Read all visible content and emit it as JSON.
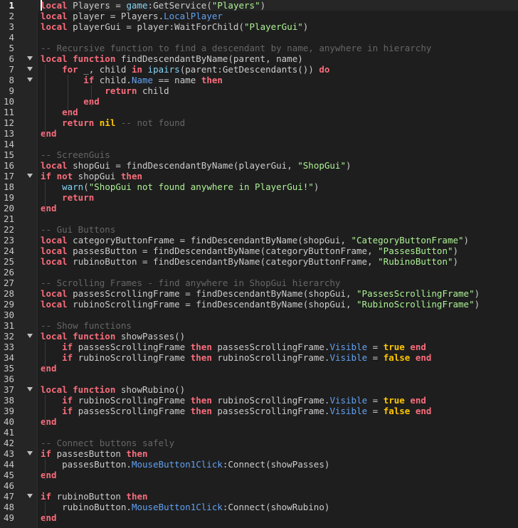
{
  "editor": {
    "lines": [
      {
        "n": "1",
        "fold": false,
        "tokens": [
          {
            "t": "local",
            "c": "kw"
          },
          {
            "t": " Players = ",
            "c": "id"
          },
          {
            "t": "game",
            "c": "bi"
          },
          {
            "t": ":GetService(",
            "c": "id"
          },
          {
            "t": "\"Players\"",
            "c": "str"
          },
          {
            "t": ")",
            "c": "id"
          }
        ]
      },
      {
        "n": "2",
        "fold": false,
        "tokens": [
          {
            "t": "local",
            "c": "kw"
          },
          {
            "t": " player = Players.",
            "c": "id"
          },
          {
            "t": "LocalPlayer",
            "c": "prop"
          }
        ]
      },
      {
        "n": "3",
        "fold": false,
        "tokens": [
          {
            "t": "local",
            "c": "kw"
          },
          {
            "t": " playerGui = player:WaitForChild(",
            "c": "id"
          },
          {
            "t": "\"PlayerGui\"",
            "c": "str"
          },
          {
            "t": ")",
            "c": "id"
          }
        ]
      },
      {
        "n": "4",
        "fold": false,
        "tokens": []
      },
      {
        "n": "5",
        "fold": false,
        "tokens": [
          {
            "t": "-- Recursive function to find a descendant by name, anywhere in hierarchy",
            "c": "com"
          }
        ]
      },
      {
        "n": "6",
        "fold": true,
        "tokens": [
          {
            "t": "local function",
            "c": "kw"
          },
          {
            "t": " findDescendantByName(parent, name)",
            "c": "id"
          }
        ]
      },
      {
        "n": "7",
        "fold": true,
        "tokens": [
          {
            "t": "    ",
            "c": "id"
          },
          {
            "t": "for",
            "c": "kw"
          },
          {
            "t": " _, child ",
            "c": "id"
          },
          {
            "t": "in",
            "c": "kw"
          },
          {
            "t": " ",
            "c": "id"
          },
          {
            "t": "ipairs",
            "c": "bi"
          },
          {
            "t": "(parent:GetDescendants()) ",
            "c": "id"
          },
          {
            "t": "do",
            "c": "kw"
          }
        ]
      },
      {
        "n": "8",
        "fold": true,
        "tokens": [
          {
            "t": "        ",
            "c": "id"
          },
          {
            "t": "if",
            "c": "kw"
          },
          {
            "t": " child.",
            "c": "id"
          },
          {
            "t": "Name",
            "c": "prop"
          },
          {
            "t": " == name ",
            "c": "id"
          },
          {
            "t": "then",
            "c": "kw"
          }
        ]
      },
      {
        "n": "9",
        "fold": false,
        "tokens": [
          {
            "t": "            ",
            "c": "id"
          },
          {
            "t": "return",
            "c": "kw"
          },
          {
            "t": " child",
            "c": "id"
          }
        ]
      },
      {
        "n": "10",
        "fold": false,
        "tokens": [
          {
            "t": "        ",
            "c": "id"
          },
          {
            "t": "end",
            "c": "kw"
          }
        ]
      },
      {
        "n": "11",
        "fold": false,
        "tokens": [
          {
            "t": "    ",
            "c": "id"
          },
          {
            "t": "end",
            "c": "kw"
          }
        ]
      },
      {
        "n": "12",
        "fold": false,
        "tokens": [
          {
            "t": "    ",
            "c": "id"
          },
          {
            "t": "return",
            "c": "kw"
          },
          {
            "t": " ",
            "c": "id"
          },
          {
            "t": "nil",
            "c": "bool"
          },
          {
            "t": " -- not found",
            "c": "com"
          }
        ]
      },
      {
        "n": "13",
        "fold": false,
        "tokens": [
          {
            "t": "end",
            "c": "kw"
          }
        ]
      },
      {
        "n": "14",
        "fold": false,
        "tokens": []
      },
      {
        "n": "15",
        "fold": false,
        "tokens": [
          {
            "t": "-- ScreenGuis",
            "c": "com"
          }
        ]
      },
      {
        "n": "16",
        "fold": false,
        "tokens": [
          {
            "t": "local",
            "c": "kw"
          },
          {
            "t": " shopGui = findDescendantByName(playerGui, ",
            "c": "id"
          },
          {
            "t": "\"ShopGui\"",
            "c": "str"
          },
          {
            "t": ")",
            "c": "id"
          }
        ]
      },
      {
        "n": "17",
        "fold": true,
        "tokens": [
          {
            "t": "if not",
            "c": "kw"
          },
          {
            "t": " shopGui ",
            "c": "id"
          },
          {
            "t": "then",
            "c": "kw"
          }
        ]
      },
      {
        "n": "18",
        "fold": false,
        "tokens": [
          {
            "t": "    ",
            "c": "id"
          },
          {
            "t": "warn",
            "c": "bi"
          },
          {
            "t": "(",
            "c": "id"
          },
          {
            "t": "\"ShopGui not found anywhere in PlayerGui!\"",
            "c": "str"
          },
          {
            "t": ")",
            "c": "id"
          }
        ]
      },
      {
        "n": "19",
        "fold": false,
        "tokens": [
          {
            "t": "    ",
            "c": "id"
          },
          {
            "t": "return",
            "c": "kw"
          }
        ]
      },
      {
        "n": "20",
        "fold": false,
        "tokens": [
          {
            "t": "end",
            "c": "kw"
          }
        ]
      },
      {
        "n": "21",
        "fold": false,
        "tokens": []
      },
      {
        "n": "22",
        "fold": false,
        "tokens": [
          {
            "t": "-- Gui Buttons",
            "c": "com"
          }
        ]
      },
      {
        "n": "23",
        "fold": false,
        "tokens": [
          {
            "t": "local",
            "c": "kw"
          },
          {
            "t": " categoryButtonFrame = findDescendantByName(shopGui, ",
            "c": "id"
          },
          {
            "t": "\"CategoryButtonFrame\"",
            "c": "str"
          },
          {
            "t": ")",
            "c": "id"
          }
        ]
      },
      {
        "n": "24",
        "fold": false,
        "tokens": [
          {
            "t": "local",
            "c": "kw"
          },
          {
            "t": " passesButton = findDescendantByName(categoryButtonFrame, ",
            "c": "id"
          },
          {
            "t": "\"PassesButton\"",
            "c": "str"
          },
          {
            "t": ")",
            "c": "id"
          }
        ]
      },
      {
        "n": "25",
        "fold": false,
        "tokens": [
          {
            "t": "local",
            "c": "kw"
          },
          {
            "t": " rubinoButton = findDescendantByName(categoryButtonFrame, ",
            "c": "id"
          },
          {
            "t": "\"RubinoButton\"",
            "c": "str"
          },
          {
            "t": ")",
            "c": "id"
          }
        ]
      },
      {
        "n": "26",
        "fold": false,
        "tokens": []
      },
      {
        "n": "27",
        "fold": false,
        "tokens": [
          {
            "t": "-- Scrolling Frames - find anywhere in ShopGui hierarchy",
            "c": "com"
          }
        ]
      },
      {
        "n": "28",
        "fold": false,
        "tokens": [
          {
            "t": "local",
            "c": "kw"
          },
          {
            "t": " passesScrollingFrame = findDescendantByName(shopGui, ",
            "c": "id"
          },
          {
            "t": "\"PassesScrollingFrame\"",
            "c": "str"
          },
          {
            "t": ")",
            "c": "id"
          }
        ]
      },
      {
        "n": "29",
        "fold": false,
        "tokens": [
          {
            "t": "local",
            "c": "kw"
          },
          {
            "t": " rubinoScrollingFrame = findDescendantByName(shopGui, ",
            "c": "id"
          },
          {
            "t": "\"RubinoScrollingFrame\"",
            "c": "str"
          },
          {
            "t": ")",
            "c": "id"
          }
        ]
      },
      {
        "n": "30",
        "fold": false,
        "tokens": []
      },
      {
        "n": "31",
        "fold": false,
        "tokens": [
          {
            "t": "-- Show functions",
            "c": "com"
          }
        ]
      },
      {
        "n": "32",
        "fold": true,
        "tokens": [
          {
            "t": "local function",
            "c": "kw"
          },
          {
            "t": " showPasses()",
            "c": "id"
          }
        ]
      },
      {
        "n": "33",
        "fold": false,
        "tokens": [
          {
            "t": "    ",
            "c": "id"
          },
          {
            "t": "if",
            "c": "kw"
          },
          {
            "t": " passesScrollingFrame ",
            "c": "id"
          },
          {
            "t": "then",
            "c": "kw"
          },
          {
            "t": " passesScrollingFrame.",
            "c": "id"
          },
          {
            "t": "Visible",
            "c": "prop"
          },
          {
            "t": " = ",
            "c": "id"
          },
          {
            "t": "true",
            "c": "bool"
          },
          {
            "t": " ",
            "c": "id"
          },
          {
            "t": "end",
            "c": "kw"
          }
        ]
      },
      {
        "n": "34",
        "fold": false,
        "tokens": [
          {
            "t": "    ",
            "c": "id"
          },
          {
            "t": "if",
            "c": "kw"
          },
          {
            "t": " rubinoScrollingFrame ",
            "c": "id"
          },
          {
            "t": "then",
            "c": "kw"
          },
          {
            "t": " rubinoScrollingFrame.",
            "c": "id"
          },
          {
            "t": "Visible",
            "c": "prop"
          },
          {
            "t": " = ",
            "c": "id"
          },
          {
            "t": "false",
            "c": "bool"
          },
          {
            "t": " ",
            "c": "id"
          },
          {
            "t": "end",
            "c": "kw"
          }
        ]
      },
      {
        "n": "35",
        "fold": false,
        "tokens": [
          {
            "t": "end",
            "c": "kw"
          }
        ]
      },
      {
        "n": "36",
        "fold": false,
        "tokens": []
      },
      {
        "n": "37",
        "fold": true,
        "tokens": [
          {
            "t": "local function",
            "c": "kw"
          },
          {
            "t": " showRubino()",
            "c": "id"
          }
        ]
      },
      {
        "n": "38",
        "fold": false,
        "tokens": [
          {
            "t": "    ",
            "c": "id"
          },
          {
            "t": "if",
            "c": "kw"
          },
          {
            "t": " rubinoScrollingFrame ",
            "c": "id"
          },
          {
            "t": "then",
            "c": "kw"
          },
          {
            "t": " rubinoScrollingFrame.",
            "c": "id"
          },
          {
            "t": "Visible",
            "c": "prop"
          },
          {
            "t": " = ",
            "c": "id"
          },
          {
            "t": "true",
            "c": "bool"
          },
          {
            "t": " ",
            "c": "id"
          },
          {
            "t": "end",
            "c": "kw"
          }
        ]
      },
      {
        "n": "39",
        "fold": false,
        "tokens": [
          {
            "t": "    ",
            "c": "id"
          },
          {
            "t": "if",
            "c": "kw"
          },
          {
            "t": " passesScrollingFrame ",
            "c": "id"
          },
          {
            "t": "then",
            "c": "kw"
          },
          {
            "t": " passesScrollingFrame.",
            "c": "id"
          },
          {
            "t": "Visible",
            "c": "prop"
          },
          {
            "t": " = ",
            "c": "id"
          },
          {
            "t": "false",
            "c": "bool"
          },
          {
            "t": " ",
            "c": "id"
          },
          {
            "t": "end",
            "c": "kw"
          }
        ]
      },
      {
        "n": "40",
        "fold": false,
        "tokens": [
          {
            "t": "end",
            "c": "kw"
          }
        ]
      },
      {
        "n": "41",
        "fold": false,
        "tokens": []
      },
      {
        "n": "42",
        "fold": false,
        "tokens": [
          {
            "t": "-- Connect buttons safely",
            "c": "com"
          }
        ]
      },
      {
        "n": "43",
        "fold": true,
        "tokens": [
          {
            "t": "if",
            "c": "kw"
          },
          {
            "t": " passesButton ",
            "c": "id"
          },
          {
            "t": "then",
            "c": "kw"
          }
        ]
      },
      {
        "n": "44",
        "fold": false,
        "tokens": [
          {
            "t": "    passesButton.",
            "c": "id"
          },
          {
            "t": "MouseButton1Click",
            "c": "prop"
          },
          {
            "t": ":Connect(showPasses)",
            "c": "id"
          }
        ]
      },
      {
        "n": "45",
        "fold": false,
        "tokens": [
          {
            "t": "end",
            "c": "kw"
          }
        ]
      },
      {
        "n": "46",
        "fold": false,
        "tokens": []
      },
      {
        "n": "47",
        "fold": true,
        "tokens": [
          {
            "t": "if",
            "c": "kw"
          },
          {
            "t": " rubinoButton ",
            "c": "id"
          },
          {
            "t": "then",
            "c": "kw"
          }
        ]
      },
      {
        "n": "48",
        "fold": false,
        "tokens": [
          {
            "t": "    rubinoButton.",
            "c": "id"
          },
          {
            "t": "MouseButton1Click",
            "c": "prop"
          },
          {
            "t": ":Connect(showRubino)",
            "c": "id"
          }
        ]
      },
      {
        "n": "49",
        "fold": false,
        "tokens": [
          {
            "t": "end",
            "c": "kw"
          }
        ]
      }
    ]
  }
}
